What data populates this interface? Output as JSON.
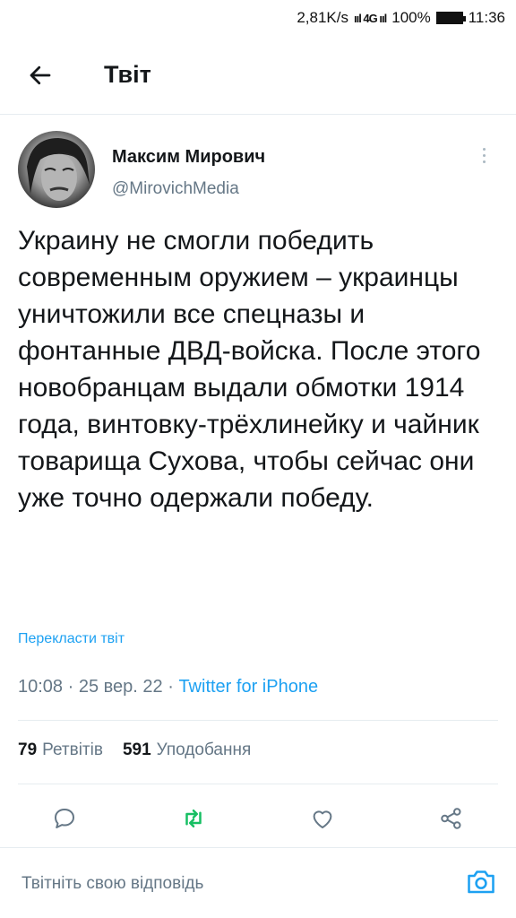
{
  "status_bar": {
    "network_speed": "2,81K/s",
    "signal": "ııl 4G ııl",
    "battery": "100%",
    "time": "11:36"
  },
  "header": {
    "back_icon": "arrow-left-icon",
    "title": "Твіт"
  },
  "tweet": {
    "author_name": "Максим Мирович",
    "author_handle": "@MirovichMedia",
    "text": "Украину не смогли победить современным оружием – украинцы уничтожили все спецназы и фонтанные ДВД-войска. После этого новобранцам выдали обмотки 1914 года, винтовку-трёхлинейку и чайник товарища Сухова, чтобы сейчас они уже точно одержали победу.",
    "translate_label": "Перекласти твіт",
    "time": "10:08",
    "date": "25 вер. 22",
    "source": "Twitter for iPhone",
    "retweets_count": "79",
    "retweets_label": "Ретвітів",
    "likes_count": "591",
    "likes_label": "Уподобання"
  },
  "actions": {
    "reply_icon": "comment-icon",
    "retweet_icon": "retweet-icon",
    "like_icon": "heart-icon",
    "share_icon": "share-icon"
  },
  "reply_bar": {
    "placeholder": "Твітніть свою відповідь",
    "camera_icon": "camera-icon"
  },
  "colors": {
    "accent": "#1da1f2",
    "retweet": "#17bf63",
    "text": "#14171a",
    "secondary": "#657786",
    "divider": "#e6ecf0"
  }
}
